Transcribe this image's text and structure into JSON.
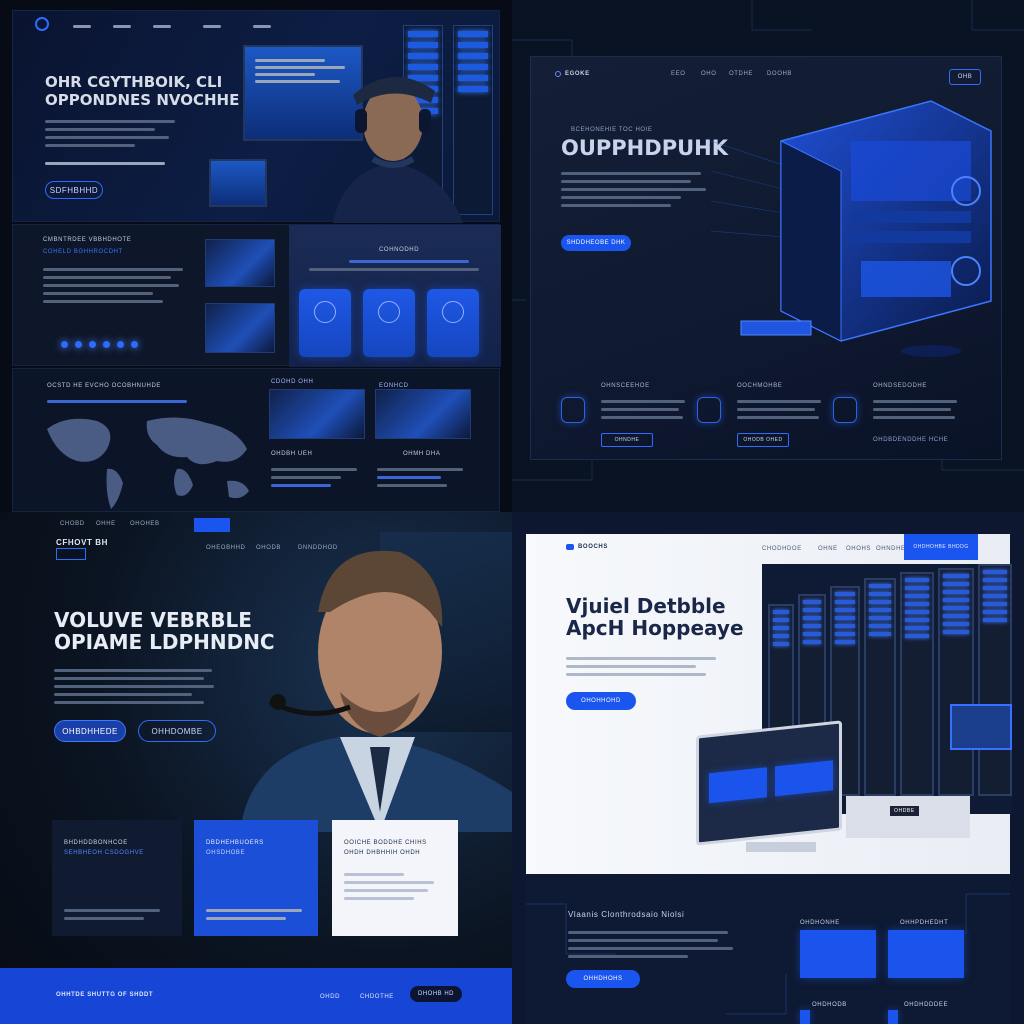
{
  "q1": {
    "hero_title_1": "OHR CGYTHBOIK, CLI",
    "hero_title_2": "OPPONDNES NVOCHHE",
    "hero_button": "SDFHBHHD",
    "section_title": "CMBNTRDEE VBBHDHOTE",
    "section_title_b": "COHELD BGHHROCDHT",
    "features_label": "COHNODHD",
    "world_title": "OCSTD HE EVCHO OCOBHNUHDE",
    "panel_label_a": "CDOHD OHH",
    "panel_label_b": "EONHCD",
    "panel_label_c": "OHDBH UEH",
    "panel_label_d": "OHMH DHA"
  },
  "q2": {
    "logo": "EGOKE",
    "nav": [
      "EEO",
      "OHO",
      "OTDHE",
      "DOOHB"
    ],
    "nav_button": "OHB",
    "kicker": "BCEHONEHIE TOC HOIE",
    "title": "OUPPHDPUHK",
    "cta": "SHDDHEOBE DHK",
    "features": [
      {
        "title": "OHNSCEEHOE",
        "button": "OHNDHE"
      },
      {
        "title": "OOCHMOHBE",
        "button": "OHODB OHED"
      },
      {
        "title": "OHNDSEDODHE",
        "button": "OHDBDENDDHE HCHE"
      }
    ]
  },
  "q3": {
    "logo": "CFHOVT BH",
    "nav": [
      "CHOBD",
      "OHHE",
      "OHOHEB",
      "OHEOBHHD",
      "OHODB",
      "DNNDDHOD"
    ],
    "title_1": "VOLUVE VEBRBLE",
    "title_2": "OPIAME LDPHNDNC",
    "btn_primary": "OHBDHHEDE",
    "btn_secondary": "OHHDOMBE",
    "cards": [
      {
        "title": "BHDHDDBONHCOE",
        "subtitle": "SEHBHEOH CSDOGHVE"
      },
      {
        "title": "DBDHEHBUOERS",
        "subtitle": "OHSDHOBE"
      },
      {
        "title": "OOICHE BODDHE CHIHS",
        "subtitle": "OHDH DHBHHIH OHDH"
      }
    ],
    "footer_text": "OHHTDE SHUTTG OF SHDDT",
    "footer_links": [
      "OHDD",
      "CHDOTHE"
    ],
    "footer_button": "DHOHB HD"
  },
  "q4": {
    "logo": "BOOCHS",
    "nav": [
      "CHODHDOE",
      "OHNE",
      "OHOHS",
      "OHNDHE"
    ],
    "nav_button": "OHDHOHBE BHDDG",
    "title_1": "Vjuiel Detbble",
    "title_2": "ApcH Hoppeaye",
    "cta": "OHOHHOHD",
    "screen_label": "OHDBE",
    "section_title": "Vlaanis Clonthrodsaio Niolsi",
    "section_button": "OHHDHOHS",
    "card_titles": [
      "OHDHONHE",
      "OHHPDHEDHT",
      "OHDHODB",
      "OHDHDDDEE"
    ]
  },
  "colors": {
    "accent": "#1b55f0",
    "dark": "#070b16",
    "navy": "#0e1a33",
    "light": "#eef1f6"
  }
}
